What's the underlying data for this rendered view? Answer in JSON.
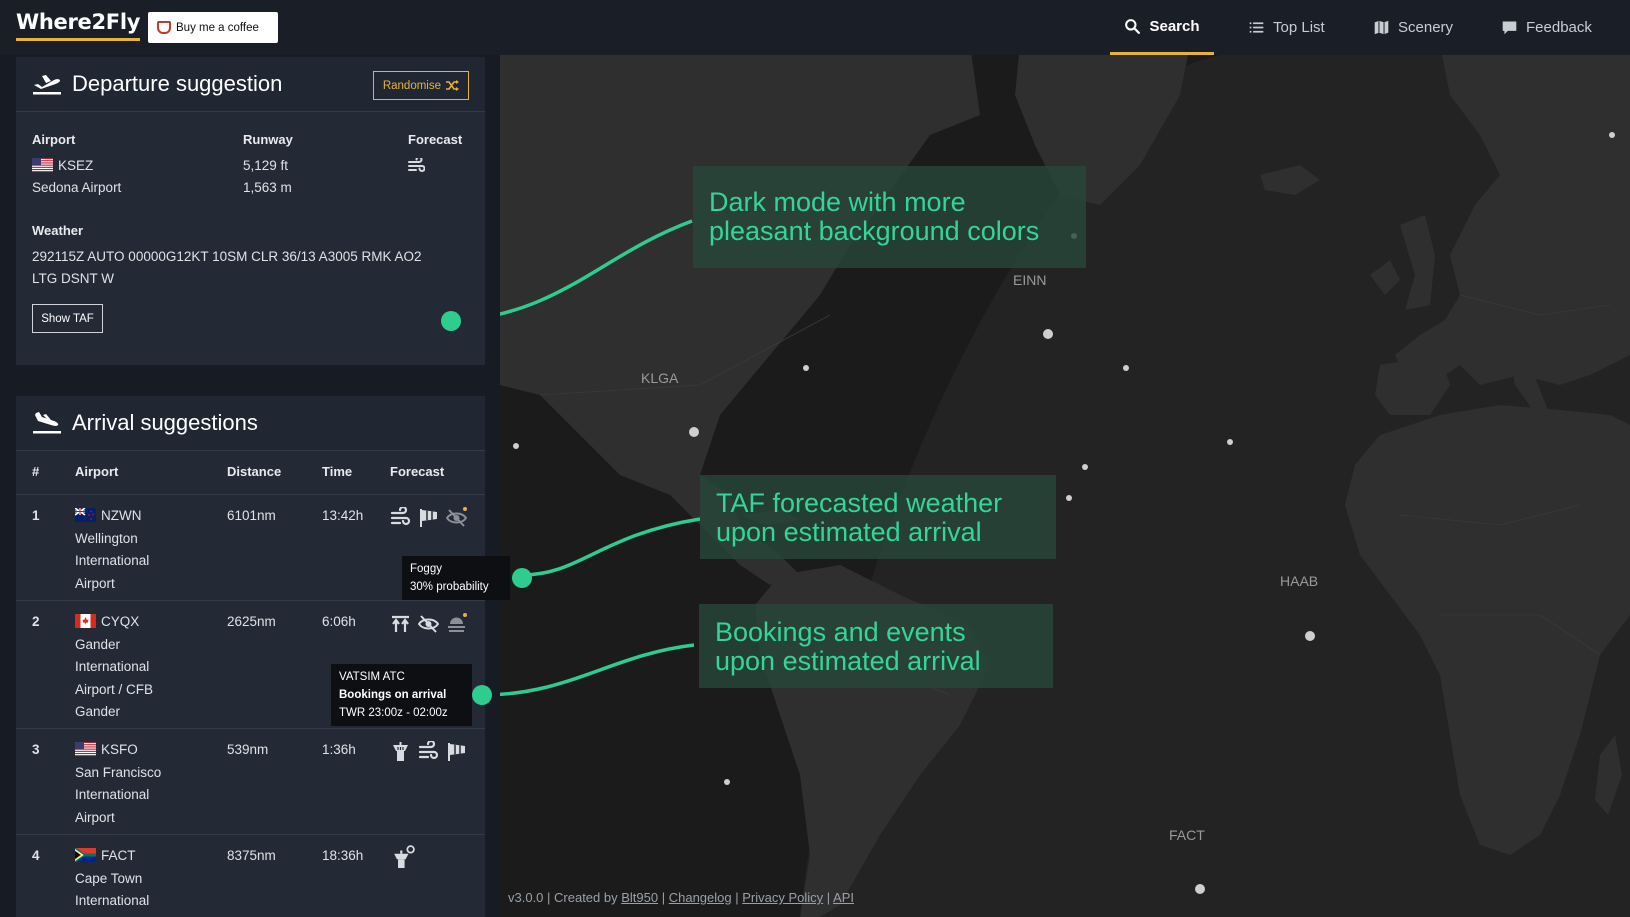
{
  "nav": {
    "logo": "Where2Fly",
    "coffee": "Buy me a coffee",
    "items": [
      {
        "label": "Search",
        "icon": "search-icon",
        "active": true
      },
      {
        "label": "Top List",
        "icon": "list-icon"
      },
      {
        "label": "Scenery",
        "icon": "map-icon"
      },
      {
        "label": "Feedback",
        "icon": "comment-icon"
      }
    ]
  },
  "departure": {
    "title": "Departure suggestion",
    "randomise": "Randomise",
    "airport_label": "Airport",
    "runway_label": "Runway",
    "forecast_label": "Forecast",
    "icao": "KSEZ",
    "name": "Sedona Airport",
    "runway_ft": "5,129 ft",
    "runway_m": "1,563 m",
    "weather_label": "Weather",
    "metar_line1": "292115Z AUTO 00000G12KT 10SM CLR 36/13 A3005 RMK AO2",
    "metar_line2": "LTG DSNT W",
    "show_taf": "Show TAF"
  },
  "arrivals": {
    "title": "Arrival suggestions",
    "headers": {
      "num": "#",
      "airport": "Airport",
      "distance": "Distance",
      "time": "Time",
      "forecast": "Forecast"
    },
    "rows": [
      {
        "num": "1",
        "icao": "NZWN",
        "name": [
          "Wellington",
          "International",
          "Airport"
        ],
        "distance": "6101nm",
        "time": "13:42h",
        "flag": "nz"
      },
      {
        "num": "2",
        "icao": "CYQX",
        "name": [
          "Gander",
          "International",
          "Airport / CFB",
          "Gander"
        ],
        "distance": "2625nm",
        "time": "6:06h",
        "flag": "ca"
      },
      {
        "num": "3",
        "icao": "KSFO",
        "name": [
          "San Francisco",
          "International",
          "Airport"
        ],
        "distance": "539nm",
        "time": "1:36h",
        "flag": "us"
      },
      {
        "num": "4",
        "icao": "FACT",
        "name": [
          "Cape Town",
          "International"
        ],
        "distance": "8375nm",
        "time": "18:36h",
        "flag": "za"
      }
    ]
  },
  "tooltips": {
    "foggy_title": "Foggy",
    "foggy_prob": "30% probability",
    "atc_title": "VATSIM ATC",
    "atc_bookings": "Bookings on arrival",
    "atc_time": "TWR 23:00z - 02:00z"
  },
  "callouts": {
    "dark_l1": "Dark mode with more",
    "dark_l2": "pleasant background colors",
    "taf_l1": "TAF forecasted weather",
    "taf_l2": "upon estimated arrival",
    "book_l1": "Bookings and events",
    "book_l2": "upon estimated arrival"
  },
  "map_labels": {
    "einn": "EINN",
    "klga": "KLGA",
    "haab": "HAAB",
    "fact": "FACT"
  },
  "footer": {
    "version": "v3.0.0 | Created by",
    "author": "Blt950",
    "changelog": "Changelog",
    "privacy": "Privacy Policy",
    "api": "API"
  },
  "colors": {
    "accent": "#e6b23a",
    "callout_text": "#33d59a",
    "connector": "#2ecc8e"
  }
}
